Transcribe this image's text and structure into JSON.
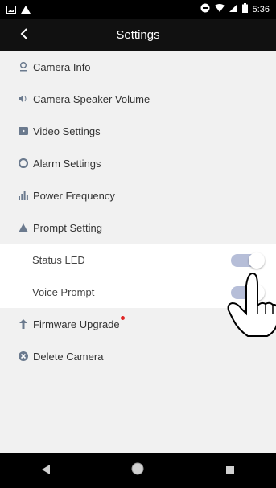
{
  "status_bar": {
    "time": "5:36",
    "left_icons": [
      "image-icon",
      "warning-icon"
    ],
    "right_icons": [
      "do-not-disturb-icon",
      "wifi-icon",
      "signal-icon",
      "battery-icon"
    ]
  },
  "app_bar": {
    "title": "Settings",
    "back_icon": "back-arrow-icon"
  },
  "menu": {
    "items": [
      {
        "label": "Camera Info",
        "icon": "pin-icon"
      },
      {
        "label": "Camera Speaker Volume",
        "icon": "speaker-icon"
      },
      {
        "label": "Video Settings",
        "icon": "video-icon"
      },
      {
        "label": "Alarm Settings",
        "icon": "alarm-icon"
      },
      {
        "label": "Power Frequency",
        "icon": "frequency-icon"
      },
      {
        "label": "Prompt Setting",
        "icon": "prompt-icon"
      }
    ],
    "sub_items": [
      {
        "label": "Status LED",
        "toggle": "on"
      },
      {
        "label": "Voice Prompt",
        "toggle": "on"
      }
    ],
    "bottom_items": [
      {
        "label": "Firmware Upgrade",
        "icon": "upload-arrow-icon",
        "badge_color": "#e02424"
      },
      {
        "label": "Delete Camera",
        "icon": "delete-icon"
      }
    ]
  },
  "colors": {
    "toggle_track": "#b6bed8",
    "toggle_knob": "#ffffff",
    "badge": "#e02424",
    "app_bar": "#111111",
    "background": "#f1f1f1"
  },
  "nav_bar": {
    "buttons": [
      "back-triangle-icon",
      "home-circle-icon",
      "recents-square-icon"
    ]
  }
}
